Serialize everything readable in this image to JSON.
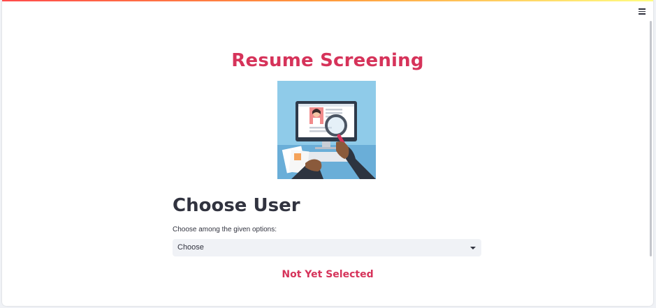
{
  "app": {
    "title": "Resume Screening",
    "menu_icon": "hamburger-menu-icon",
    "accent_color": "#d6335a"
  },
  "hero": {
    "icon": "resume-search-illustration"
  },
  "section": {
    "heading": "Choose User",
    "select_label": "Choose among the given options:",
    "select_value": "Choose"
  },
  "status": {
    "text": "Not Yet Selected"
  }
}
